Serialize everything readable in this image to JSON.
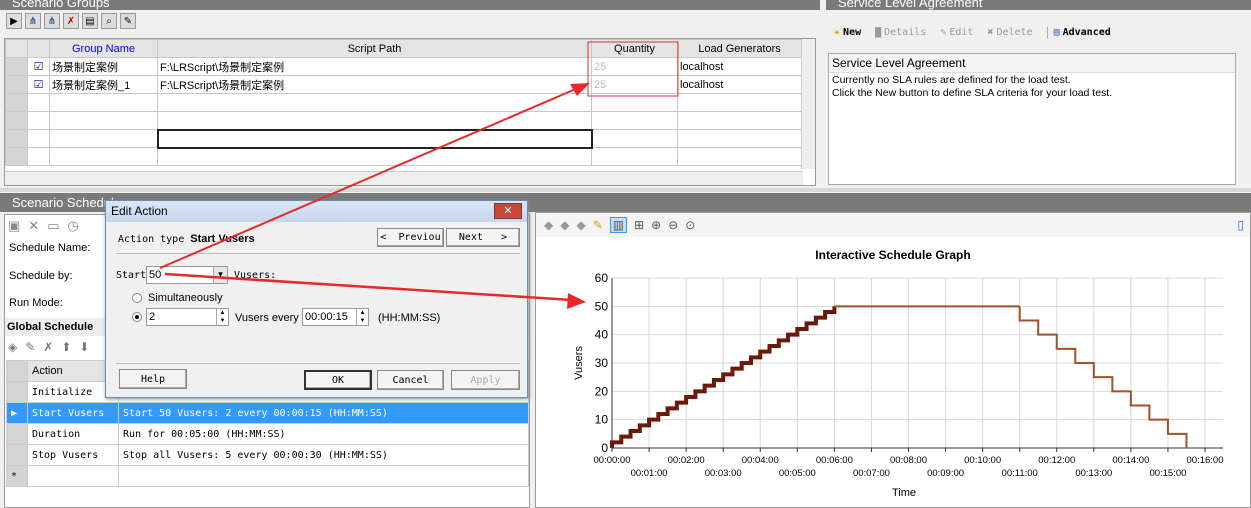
{
  "scenario_groups": {
    "title": "Scenario Groups",
    "toolbar": [
      "play-icon",
      "vusers-icon",
      "add-vusers-icon",
      "remove-vusers-icon",
      "details-icon",
      "view-script-icon",
      "edit-icon"
    ],
    "columns": [
      "Group Name",
      "Script Path",
      "Quantity",
      "Load Generators"
    ],
    "rows": [
      {
        "checked": true,
        "name": "场景制定案例",
        "path": "F:\\LRScript\\场景制定案例",
        "quantity": "25",
        "generator": "localhost"
      },
      {
        "checked": true,
        "name": "场景制定案例_1",
        "path": "F:\\LRScript\\场景制定案例",
        "quantity": "25",
        "generator": "localhost"
      }
    ]
  },
  "sla": {
    "title": "Service Level Agreement",
    "new": "New",
    "details": "Details",
    "edit": "Edit",
    "delete": "Delete",
    "advanced": "Advanced",
    "box_title": "Service Level Agreement",
    "line1": "Currently no SLA rules are defined for the load test.",
    "line2": "Click the New button to define SLA criteria for your load test."
  },
  "schedule": {
    "title": "Scenario Schedule",
    "name_label": "Schedule Name:",
    "by_label": "Schedule by:",
    "mode_label": "Run Mode:",
    "global_title": "Global Schedule",
    "action_col": "Action",
    "rows": [
      {
        "action": "Initialize",
        "props": ""
      },
      {
        "action": "Start  Vusers",
        "props": "Start 50 Vusers: 2 every 00:00:15 (HH:MM:SS)",
        "selected": true
      },
      {
        "action": "Duration",
        "props": "Run for 00:05:00 (HH:MM:SS)"
      },
      {
        "action": "Stop Vusers",
        "props": "Stop all Vusers: 5 every 00:00:30 (HH:MM:SS)"
      }
    ],
    "new_row": "*"
  },
  "dialog": {
    "title": "Edit Action",
    "type_label": "Action type",
    "type_value": "Start Vusers",
    "previous": "Previou",
    "next": "Next",
    "start_label": "Start",
    "start_value": "50",
    "vusers_label": "Vusers:",
    "simultaneously": "Simultaneously",
    "count": "2",
    "every_label": "Vusers every",
    "interval": "00:00:15",
    "format": "(HH:MM:SS)",
    "help": "Help",
    "ok": "OK",
    "cancel": "Cancel",
    "apply": "Apply",
    "selected_option": "gradual"
  },
  "colors": {
    "ramp": "#6b1a05",
    "stop": "#a0522d",
    "selection": "#3399ff",
    "annotation": "#e8282a"
  },
  "chart_data": {
    "type": "line",
    "title": "Interactive Schedule Graph",
    "xlabel": "Time",
    "ylabel": "Vusers",
    "ylim": [
      0,
      60
    ],
    "xlim": [
      "00:00:00",
      "00:16:00"
    ],
    "grid": true,
    "yticks": [
      "0",
      "10",
      "20",
      "30",
      "40",
      "50",
      "60"
    ],
    "xticks": [
      "00:00:00",
      "00:01:00",
      "00:02:00",
      "00:03:00",
      "00:04:00",
      "00:05:00",
      "00:06:00",
      "00:07:00",
      "00:08:00",
      "00:09:00",
      "00:10:00",
      "00:11:00",
      "00:12:00",
      "00:13:00",
      "00:14:00",
      "00:15:00",
      "00:16:00"
    ],
    "series": [
      {
        "segment": "start",
        "step": "00:00:15",
        "step_vusers": 2,
        "from": "00:00:00",
        "to": "00:06:00",
        "vusers_end": 50
      },
      {
        "segment": "duration",
        "from": "00:06:00",
        "to": "00:11:00",
        "vusers": 50
      },
      {
        "segment": "stop",
        "step": "00:00:30",
        "step_vusers": 5,
        "from": "00:11:00",
        "to": "00:15:30",
        "vusers_end": 0
      }
    ]
  }
}
